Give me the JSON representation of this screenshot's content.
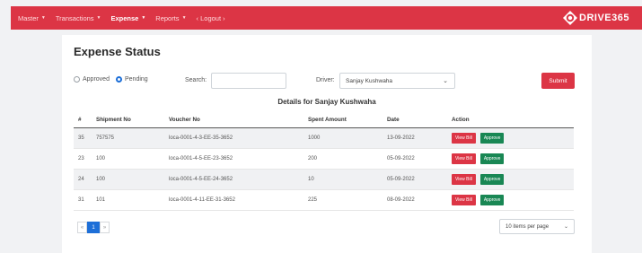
{
  "nav": {
    "items": [
      {
        "label": "Master",
        "active": false
      },
      {
        "label": "Transactions",
        "active": false
      },
      {
        "label": "Expense",
        "active": true
      },
      {
        "label": "Reports",
        "active": false
      }
    ],
    "logout": "‹ Logout ›",
    "brand": "DRIVE365"
  },
  "page": {
    "title": "Expense Status"
  },
  "filters": {
    "approved_label": "Approved",
    "pending_label": "Pending",
    "selected": "Pending",
    "search_label": "Search:",
    "search_value": "",
    "driver_label": "Driver:",
    "driver_value": "Sanjay Kushwaha",
    "submit_label": "Submit"
  },
  "details_title": "Details for Sanjay Kushwaha",
  "table": {
    "headers": [
      "#",
      "Shipment No",
      "Voucher No",
      "Spent Amount",
      "Date",
      "Action"
    ],
    "rows": [
      {
        "id": "35",
        "shipment": "757575",
        "voucher": "loca-0001-4-3-EE-35-3652",
        "amount": "1000",
        "date": "13-09-2022"
      },
      {
        "id": "23",
        "shipment": "100",
        "voucher": "loca-0001-4-5-EE-23-3652",
        "amount": "200",
        "date": "05-09-2022"
      },
      {
        "id": "24",
        "shipment": "100",
        "voucher": "loca-0001-4-5-EE-24-3652",
        "amount": "10",
        "date": "05-09-2022"
      },
      {
        "id": "31",
        "shipment": "101",
        "voucher": "loca-0001-4-11-EE-31-3652",
        "amount": "225",
        "date": "08-09-2022"
      }
    ],
    "view_label": "View Bill",
    "approve_label": "Approve"
  },
  "pagination": {
    "prev": "«",
    "current": "1",
    "next": "»",
    "per_page": "10 items per page"
  },
  "colors": {
    "accent": "#dc3545",
    "approve": "#198754",
    "primary": "#1d6fd8"
  }
}
